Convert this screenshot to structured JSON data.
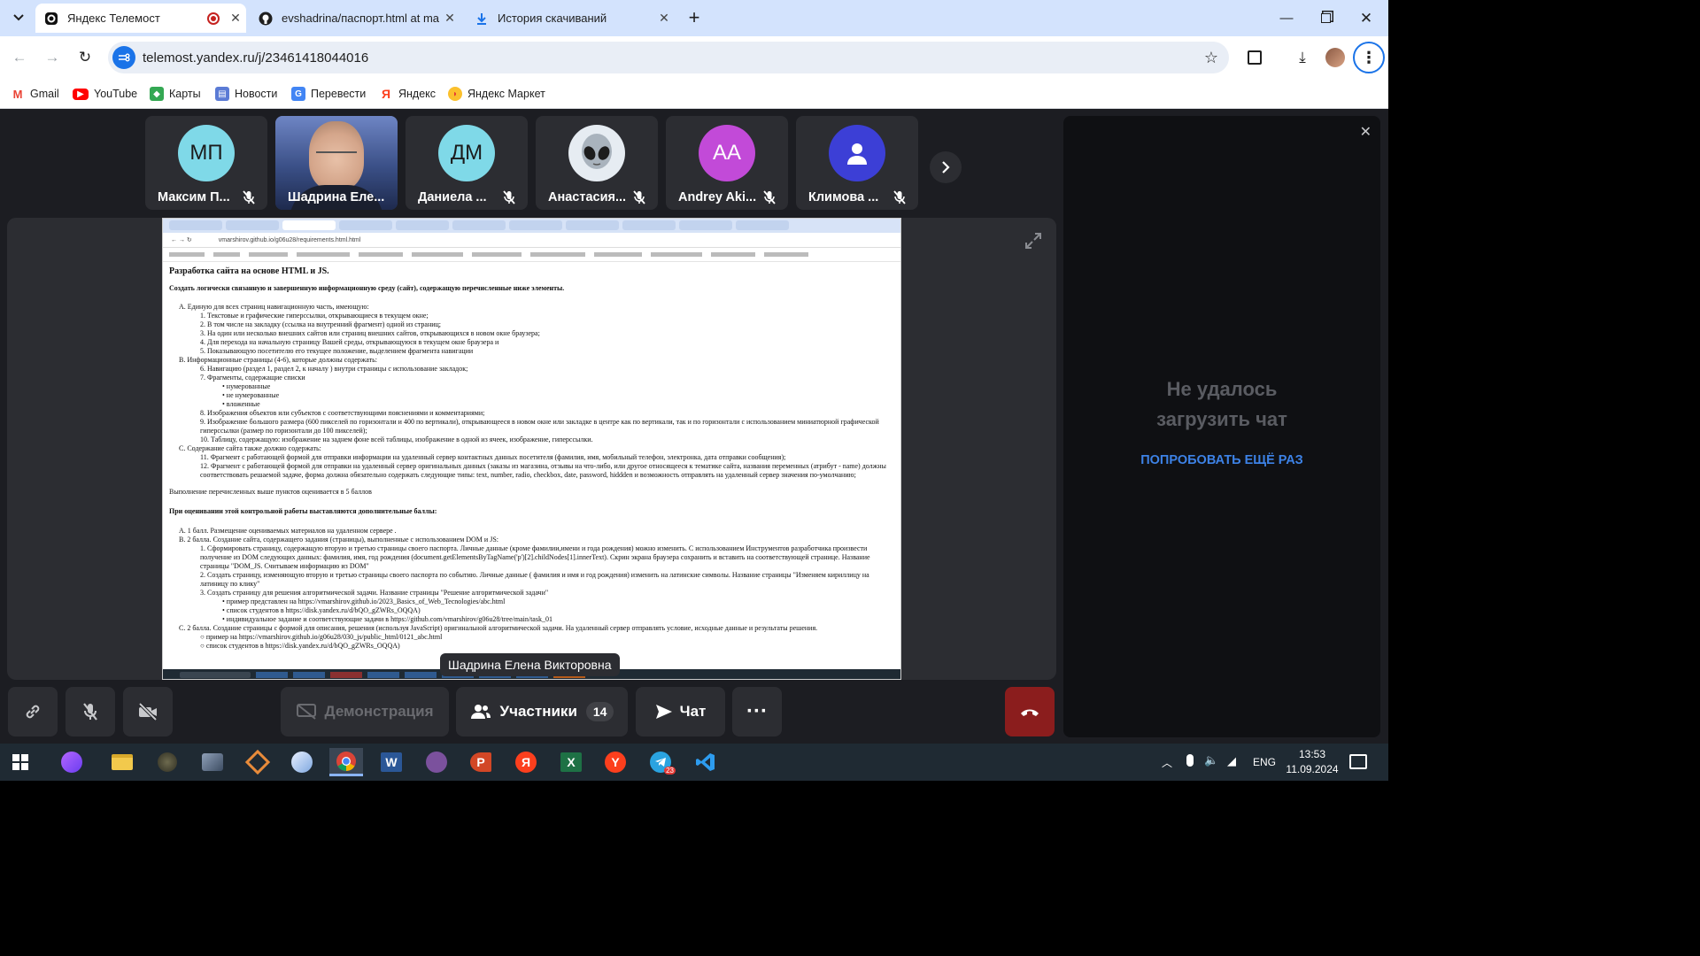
{
  "browser": {
    "tabs": [
      {
        "title": "Яндекс Телемост",
        "icon": "telemost-icon",
        "recording": true
      },
      {
        "title": "evshadrina/паспорт.html at ma",
        "icon": "github-icon"
      },
      {
        "title": "История скачиваний",
        "icon": "download-icon"
      }
    ],
    "url": "telemost.yandex.ru/j/23461418044016",
    "bookmarks": [
      "Gmail",
      "YouTube",
      "Карты",
      "Новости",
      "Перевести",
      "Яндекс",
      "Яндекс Маркет"
    ]
  },
  "meeting": {
    "participants": [
      {
        "initials": "МП",
        "name": "Максим П...",
        "color": "#7fd9e8",
        "muted": true
      },
      {
        "initials": "",
        "name": "Шадрина Еле...",
        "color": "#6b7fb0",
        "muted": false,
        "video": true
      },
      {
        "initials": "ДМ",
        "name": "Даниела ...",
        "color": "#7fd9e8",
        "muted": true
      },
      {
        "initials": "",
        "name": "Анастасия...",
        "color": "#e6ecf2",
        "muted": true,
        "alien": true
      },
      {
        "initials": "АА",
        "name": "Andrey Aki...",
        "color": "#c24ad8",
        "muted": true
      },
      {
        "initials": "",
        "name": "Климова ...",
        "color": "#3c3fd6",
        "muted": true,
        "user": true
      }
    ],
    "presenter_label": "Шадрина Елена Викторовна",
    "controls": {
      "demo": "Демонстрация",
      "participants": "Участники",
      "participants_count": "14",
      "chat": "Чат"
    },
    "chat_panel": {
      "error": "Не удалось загрузить чат",
      "retry": "ПОПРОБОВАТЬ ЕЩЁ РАЗ"
    }
  },
  "shared_doc": {
    "url": "vmarshirov.github.io/g06u28/requirements.html.html",
    "title": "Разработка сайта на основе HTML и JS.",
    "intro": "Создать логически связанную и завершенную информационную среду (сайт), содержащую перечисленные ниже элементы.",
    "lines": [
      "A. Единую для всех страниц навигационную часть, имеющую:",
      "1. Текстовые и графические гиперссылки, открывающиеся в текущем окне;",
      "2. В том числе на закладку (ссылка на внутренний фрагмент) одной из страниц;",
      "3. На один или несколько внешних сайтов или страниц внешних сайтов, открывающихся в новом окне браузера;",
      "4. Для перехода на начальную страницу Вашей среды, открывающуюся в текущем окне браузера и",
      "5. Показывающую посетителю его текущее положение, выделением фрагмента навигации",
      "B. Информационные страницы (4-6), которые должны содержать:",
      "6. Навигацию (раздел 1, раздел 2, к началу ) внутри страницы с использование закладок;",
      "7. Фрагменты, содержащие списки",
      "• нумерованные",
      "• не нумерованные",
      "• вложенные",
      "8. Изображения объектов или субъектов с соответствующими пояснениями и комментариями;",
      "9. Изображение большого размера (600 пикселей по горизонтали и 400 по вертикали), открывающееся в новом окне или закладке в центре как по вертикали, так и по горизонтали с использованием миниатюрной графической гиперссылки (размер по горизонтали до 100 пикселей);",
      "10. Таблицу, содержащую: изображение на заднем фоне всей таблицы, изображение в одной из ячеек, изображение, гиперссылки.",
      "C. Содержание сайта также должно содержать:",
      "11. Фрагмент с работающей формой для отправки информации на удаленный сервер контактных данных посетителя (фамилия, имя, мобильный телефон, электронка, дата отправки сообщения);",
      "12. Фрагмент с работающей формой для отправки на удаленный сервер оригинальных данных (заказы из магазина, отзывы на что-либо, или другое относящееся к тематике сайта, названия переменных (атрибут - name) должны соответствовать решаемой задаче, форма должна обязательно содержать следующие типы: text, number, radio, checkbox, date, password, hiddden и возможность отправлять на удаленный сервер значения по-умолчанию;"
    ],
    "score_line": "Выполнение перечисленных выше пунктов оценивается в 5 баллов",
    "extra_title": "При оценивании этой контрольной работы выставляются дополнительные баллы:",
    "extra_lines": [
      "A. 1 балл. Размещение оцениваемых материалов на удаленном сервере .",
      "B. 2 балла. Создание сайта, содержащего задания (страницы), выполненные с использованием DOM и JS:",
      "1. Сформировать страницу, содержащую вторую и третью страницы своего паспорта. Личные данные (кроме фамилии,имени и года рождения) можно изменить. С использованием Инструментов разработчика произвести получение из DOM следующих данных: фамилия, имя, год рождения (document.getElementsByTagName('p')[2].childNodes[1].innerText). Скрин экрана браузера сохранить и вставить на соответствующей странице. Название страницы \"DOM_JS. Считываем информацию из DOM\"",
      "2. Создать страницу, изменяющую вторую и третью страницы своего паспорта по событию. Личные данные ( фамилия и имя и год рождения) изменить на латинские символы. Название страницы \"Изменяем кириллицу на латиницу по клику\"",
      "3. Создать страницу для решения алгоритмической задачи. Название страницы \"Решение алгоритмической задачи\"",
      "• пример представлен на https://vmarshirov.github.io/2023_Basics_of_Web_Tecnologies/abc.html",
      "• список студентов в https://disk.yandex.ru/d/bQO_gZWRs_OQQA)",
      "• индивидуальное задание и соответствующие задачи в https://github.com/vmarshirov/g06u28/tree/main/task_01",
      "C. 2 балла. Создание страницы с формой для описания, решения (используя JavaScript) оригинальной алгоритмической задачи. На удаленный сервер отправлять условие, исходные данные и результаты решения.",
      "○ пример на https://vmarshirov.github.io/g06u28/030_js/public_html/0121_abc.html",
      "○ список студентов в https://disk.yandex.ru/d/bQO_gZWRs_OQQA)"
    ]
  },
  "taskbar": {
    "lang": "ENG",
    "time": "13:53",
    "date": "11.09.2024",
    "telegram_badge": "23"
  }
}
